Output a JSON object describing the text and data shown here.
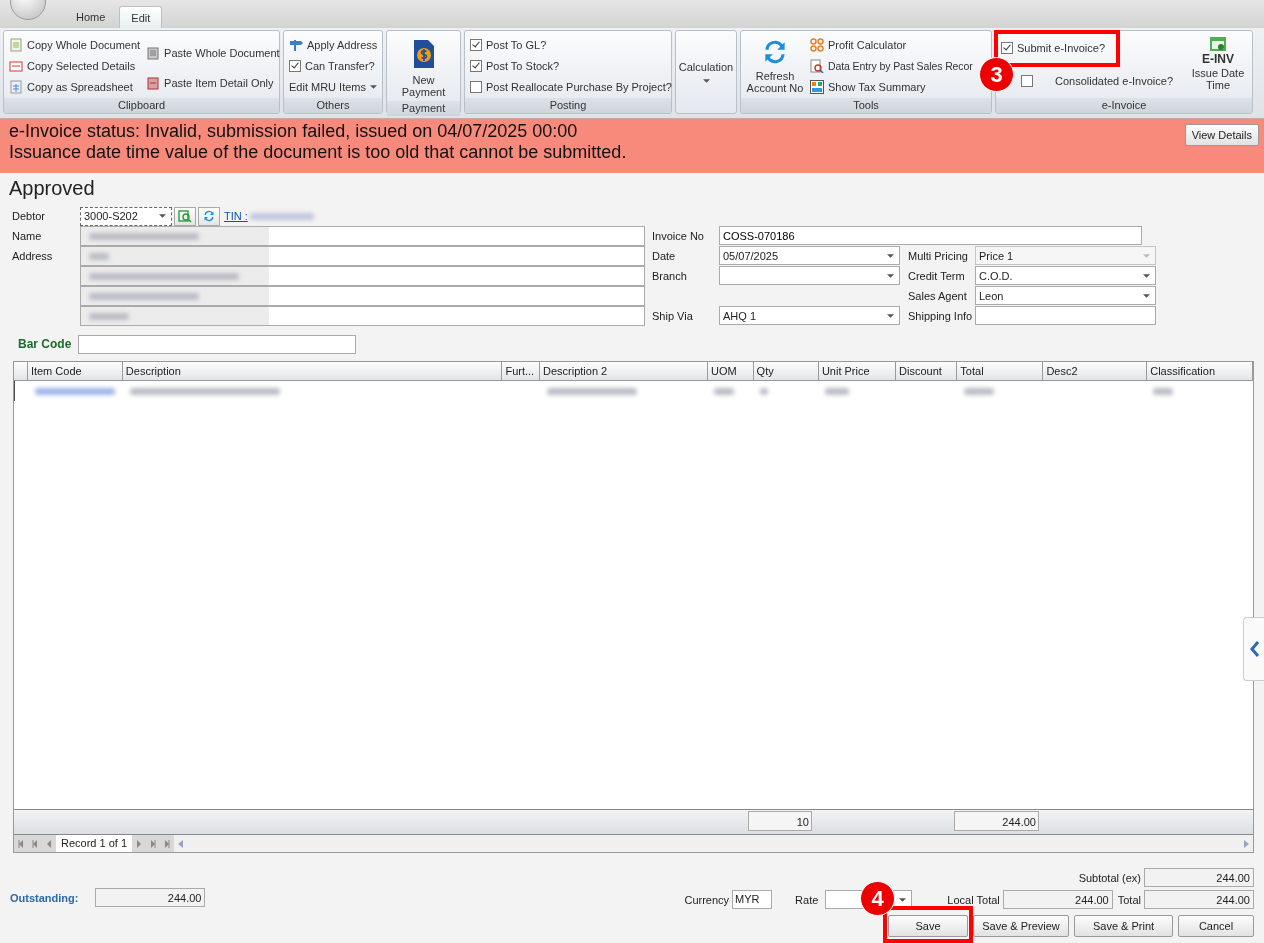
{
  "app_tabs": [
    {
      "label": "Home",
      "selected": false
    },
    {
      "label": "Edit",
      "selected": true
    }
  ],
  "ribbon": {
    "clipboard": {
      "title": "Clipboard",
      "copy_whole": "Copy Whole Document",
      "copy_selected": "Copy Selected Details",
      "copy_spreadsheet": "Copy as Spreadsheet",
      "paste_whole": "Paste Whole Document",
      "paste_item": "Paste Item Detail Only"
    },
    "others": {
      "title": "Others",
      "apply_address": "Apply Address",
      "can_transfer": {
        "label": "Can Transfer?",
        "checked": true
      },
      "mru": "Edit MRU Items"
    },
    "payment": {
      "title": "Payment",
      "new_payment": "New Payment"
    },
    "posting": {
      "title": "Posting",
      "checks": [
        {
          "label": "Post To GL?",
          "checked": true
        },
        {
          "label": "Post To Stock?",
          "checked": true
        },
        {
          "label": "Post Reallocate Purchase By Project?",
          "checked": false
        }
      ]
    },
    "calculation": {
      "label": "Calculation"
    },
    "tools": {
      "title": "Tools",
      "refresh": "Refresh Account No",
      "profit": "Profit Calculator",
      "past_sales": "Data Entry by Past Sales Recor",
      "tax_summary": "Show Tax Summary"
    },
    "einvoice": {
      "title": "e-Invoice",
      "submit": {
        "label": "Submit e-Invoice?",
        "checked": true
      },
      "consolidated": {
        "label": "Consolidated e-Invoice?",
        "checked": false
      },
      "badge": "E-INV",
      "issue": "Issue Date Time"
    }
  },
  "banner": {
    "lines": [
      "e-Invoice status: Invalid, submission failed, issued on 04/07/2025 00:00",
      "Issuance date time value of the document is too old that cannot be submitted."
    ],
    "button": "View Details"
  },
  "status": "Approved",
  "form": {
    "debtor_label": "Debtor",
    "debtor_value": "3000-S202",
    "tin_link": "TIN :",
    "name_label": "Name",
    "address_label": "Address",
    "fields": [
      {
        "label": "Invoice No",
        "value": "COSS-070186",
        "kind": "text",
        "disabled": false
      },
      {
        "label": "Date",
        "value": "05/07/2025",
        "kind": "combo",
        "disabled": false
      },
      {
        "label": "Branch",
        "kind": "combo",
        "disabled": false
      },
      {
        "label": "Ship Via",
        "value": "AHQ 1",
        "kind": "combo",
        "disabled": false
      },
      {
        "label": "Multi Pricing",
        "value": "Price 1",
        "kind": "combo",
        "disabled": true
      },
      {
        "label": "Credit Term",
        "value": "C.O.D.",
        "kind": "combo",
        "disabled": false
      },
      {
        "label": "Sales Agent",
        "value": "Leon",
        "kind": "combo",
        "disabled": false
      },
      {
        "label": "Shipping Info",
        "kind": "text",
        "disabled": false
      }
    ]
  },
  "bar_code_label": "Bar Code",
  "table": {
    "columns": [
      "Item Code",
      "Description",
      "Furt...",
      "Description 2",
      "UOM",
      "Qty",
      "Unit Price",
      "Discount",
      "Total",
      "Desc2",
      "Classification"
    ],
    "footer": {
      "qty": "10",
      "total": "244.00"
    },
    "record": "Record 1 of 1"
  },
  "summary": {
    "outstanding_label": "Outstanding:",
    "outstanding": "244.00",
    "subtotal_label": "Subtotal (ex)",
    "subtotal": "244.00",
    "currency_label": "Currency",
    "currency": "MYR",
    "rate_label": "Rate",
    "local_total_label": "Local Total",
    "local_total": "244.00",
    "total_label": "Total",
    "total": "244.00"
  },
  "buttons": [
    "Save",
    "Save & Preview",
    "Save & Print",
    "Cancel"
  ],
  "annotations": [
    {
      "label": "3"
    },
    {
      "label": "4"
    }
  ]
}
